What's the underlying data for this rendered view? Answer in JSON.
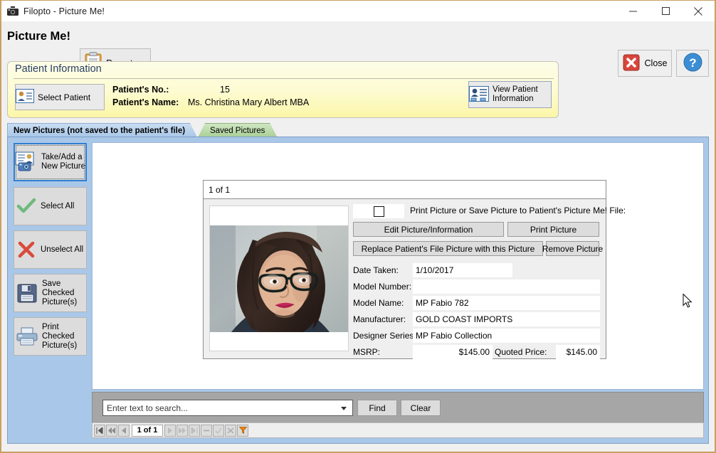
{
  "window": {
    "title": "Filopto - Picture Me!",
    "icon": "camera-icon",
    "minimize": "minimize-icon",
    "maximize": "maximize-icon",
    "close": "close-icon"
  },
  "header": {
    "app_title": "Picture Me!",
    "reports_label": "Reports",
    "reports_icon": "clipboard-icon",
    "close_label": "Close",
    "close_icon": "red-x-icon",
    "help_icon": "question-mark-icon"
  },
  "patient_information": {
    "group_title": "Patient Information",
    "select_patient_label": "Select Patient",
    "select_patient_icon": "id-card-icon",
    "number_label": "Patient's No.:",
    "number_value": "15",
    "name_label": "Patient's Name:",
    "name_value": "Ms. Christina Mary Albert MBA",
    "view_patient_line1": "View Patient",
    "view_patient_line2": "Information",
    "view_patient_icon": "id-badge-icon"
  },
  "tabs": [
    {
      "label": "New Pictures (not saved to the patient's file)",
      "active": true
    },
    {
      "label": "Saved Pictures",
      "active": false
    }
  ],
  "sidebar": {
    "items": [
      {
        "line1": "Take/Add a",
        "line2": "New Picture",
        "line3": "",
        "icon": "add-picture-icon",
        "selected": true
      },
      {
        "line1": "Select All",
        "line2": "",
        "line3": "",
        "icon": "green-check-icon",
        "selected": false
      },
      {
        "line1": "Unselect All",
        "line2": "",
        "line3": "",
        "icon": "red-x-icon",
        "selected": false
      },
      {
        "line1": "Save",
        "line2": "Checked",
        "line3": "Picture(s)",
        "icon": "floppy-disk-icon",
        "selected": false
      },
      {
        "line1": "Print",
        "line2": "Checked",
        "line3": "Picture(s)",
        "icon": "printer-icon",
        "selected": false
      }
    ]
  },
  "card": {
    "record_counter": "1 of 1",
    "photo_alt": "patient-photo",
    "checkbox_checked": false,
    "checkbox_label": "Print Picture or Save Picture to Patient's Picture Me! File:",
    "buttons": {
      "edit": "Edit Picture/Information",
      "print": "Print Picture",
      "replace": "Replace Patient's File Picture with this Picture",
      "remove": "Remove Picture"
    },
    "fields": [
      {
        "label": "Date Taken:",
        "value": "1/10/2017"
      },
      {
        "label": "Model Number:",
        "value": ""
      },
      {
        "label": "Model Name:",
        "value": "MP Fabio 782"
      },
      {
        "label": "Manufacturer:",
        "value": "GOLD COAST IMPORTS"
      },
      {
        "label": "Designer Series:",
        "value": "MP Fabio Collection"
      }
    ],
    "msrp_label": "MSRP:",
    "msrp_value": "$145.00",
    "quoted_label": "Quoted Price:",
    "quoted_value": "$145.00"
  },
  "search": {
    "placeholder": "Enter text to search...",
    "value": "",
    "find_label": "Find",
    "clear_label": "Clear"
  },
  "navigator": {
    "position": "1 of 1",
    "buttons": [
      {
        "name": "nav-first",
        "icon": "first-record-icon"
      },
      {
        "name": "nav-prev-page",
        "icon": "prev-page-icon"
      },
      {
        "name": "nav-prev",
        "icon": "prev-record-icon"
      },
      {
        "name": "nav-next",
        "icon": "next-record-icon"
      },
      {
        "name": "nav-next-page",
        "icon": "next-page-icon"
      },
      {
        "name": "nav-last",
        "icon": "last-record-icon"
      },
      {
        "name": "nav-delete",
        "icon": "minus-icon"
      },
      {
        "name": "nav-accept",
        "icon": "check-icon"
      },
      {
        "name": "nav-cancel",
        "icon": "cancel-icon"
      },
      {
        "name": "nav-filter",
        "icon": "funnel-icon"
      }
    ]
  },
  "colors": {
    "window_border": "#c9a063",
    "panel_blue": "#a9c7e8",
    "patient_yellow": "#fbf6a8",
    "tab_green": "#a9cf96",
    "accent_orange": "#e8820c",
    "focus_blue": "#2f7fd0"
  }
}
